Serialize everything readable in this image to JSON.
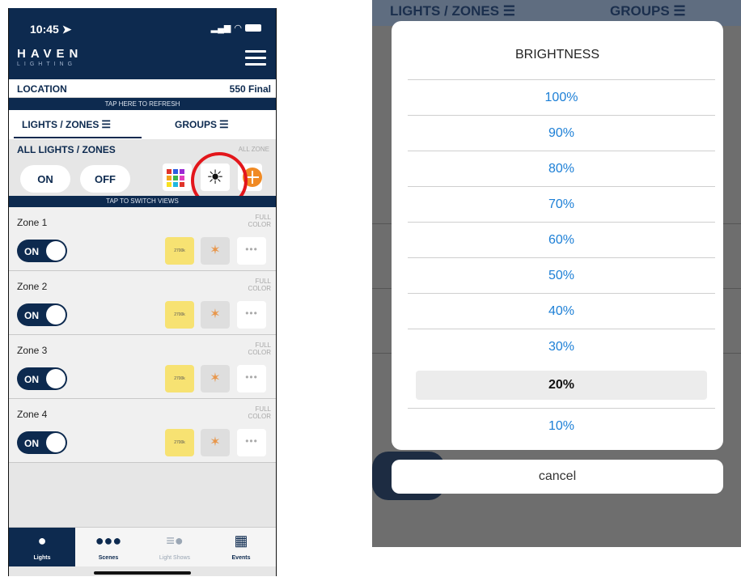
{
  "left_screen": {
    "status": {
      "time": "10:45 ➤"
    },
    "logo": {
      "main": "HAVEN",
      "sub": "LIGHTING"
    },
    "location": {
      "label": "LOCATION",
      "value": "550 Final"
    },
    "refresh_text": "TAP HERE TO REFRESH",
    "tabs": [
      {
        "label": "LIGHTS / ZONES",
        "icon": "list-icon",
        "active": true
      },
      {
        "label": "GROUPS",
        "icon": "list-icon",
        "active": false
      }
    ],
    "all_lights": {
      "title": "ALL LIGHTS / ZONES",
      "zone_caption": "ALL ZONE",
      "on_label": "ON",
      "off_label": "OFF"
    },
    "switch_views_text": "TAP TO SWITCH VIEWS",
    "zones": [
      {
        "name": "Zone 1",
        "mode": "FULL COLOR",
        "toggle": "ON",
        "temp": "2700k"
      },
      {
        "name": "Zone 2",
        "mode": "FULL COLOR",
        "toggle": "ON",
        "temp": "2700k"
      },
      {
        "name": "Zone 3",
        "mode": "FULL COLOR",
        "toggle": "ON",
        "temp": "2700k"
      },
      {
        "name": "Zone 4",
        "mode": "FULL COLOR",
        "toggle": "ON",
        "temp": "2700k"
      }
    ],
    "nav": [
      {
        "label": "Lights",
        "icon": "bulb-icon",
        "active": true
      },
      {
        "label": "Scenes",
        "icon": "bulbs-icon",
        "active": false
      },
      {
        "label": "Light Shows",
        "icon": "light-show-icon",
        "active": false
      },
      {
        "label": "Events",
        "icon": "calendar-icon",
        "active": false
      }
    ],
    "colors": {
      "navy": "#0d2a4f",
      "highlight_ring": "#e3161b",
      "temp_tile": "#f7e272"
    }
  },
  "right_screen": {
    "background_tabs": [
      {
        "label": "LIGHTS / ZONES"
      },
      {
        "label": "GROUPS"
      }
    ],
    "sheet_title": "BRIGHTNESS",
    "options": [
      "100%",
      "90%",
      "80%",
      "70%",
      "60%",
      "50%",
      "40%",
      "30%",
      "20%",
      "10%"
    ],
    "selected_option": "20%",
    "cancel_label": "cancel",
    "colors": {
      "option_text": "#1c7fd6"
    }
  }
}
